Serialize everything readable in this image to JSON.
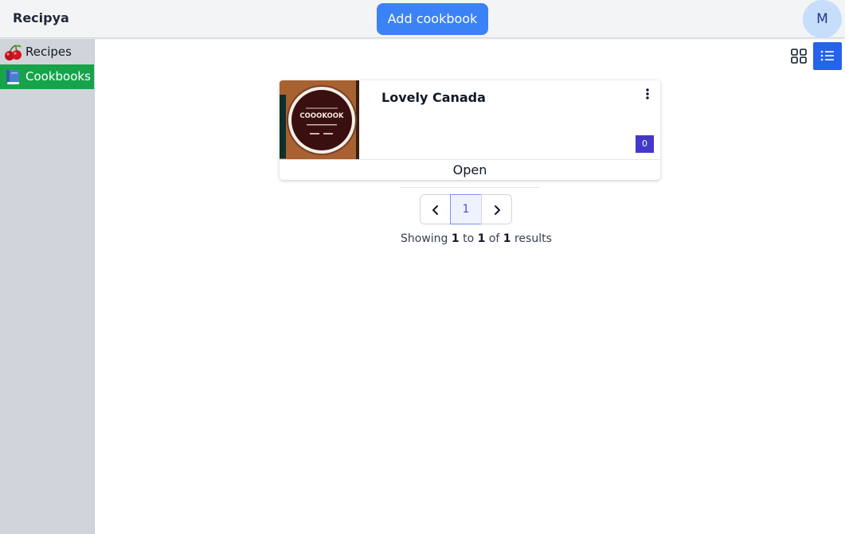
{
  "app": {
    "brand": "Recipya"
  },
  "header": {
    "add_button": "Add cookbook",
    "avatar_initial": "M"
  },
  "sidebar": {
    "items": [
      {
        "label": "Recipes",
        "icon": "cherries-icon",
        "active": false
      },
      {
        "label": "Cookbooks",
        "icon": "blue-book-icon",
        "active": true
      }
    ]
  },
  "view": {
    "grid_icon": "grid-view-icon",
    "list_icon": "list-view-icon",
    "active": "list"
  },
  "cookbooks": [
    {
      "title": "Lovely Canada",
      "image_text": "COOOKOOK",
      "recipe_count": "0",
      "open_label": "Open"
    }
  ],
  "pagination": {
    "current_page": "1",
    "showing_prefix": "Showing",
    "from": "1",
    "to_word": "to",
    "to": "1",
    "of_word": "of",
    "total": "1",
    "results_word": "results"
  },
  "colors": {
    "primary_button": "#3b82f6",
    "active_sidebar": "#16a34a",
    "badge": "#4338ca",
    "list_toggle_active": "#2563eb"
  }
}
